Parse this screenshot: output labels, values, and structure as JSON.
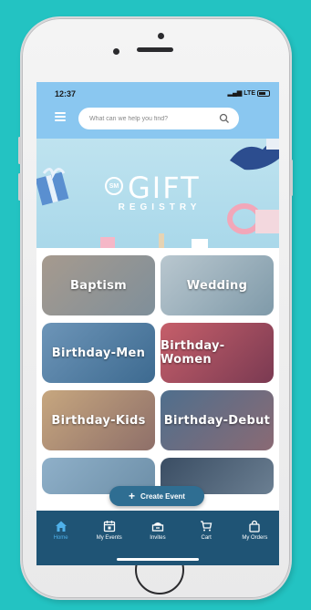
{
  "status_bar": {
    "time": "12:37",
    "network": "LTE"
  },
  "search": {
    "placeholder": "What can we help you find?"
  },
  "banner": {
    "title": "GIFT",
    "subtitle": "REGISTRY",
    "logo": "SM"
  },
  "categories": [
    {
      "label": "Baptism"
    },
    {
      "label": "Wedding"
    },
    {
      "label": "Birthday-Men"
    },
    {
      "label": "Birthday-Women"
    },
    {
      "label": "Birthday-Kids"
    },
    {
      "label": "Birthday-Debut"
    }
  ],
  "create_event": {
    "label": "Create Event"
  },
  "bottom_nav": [
    {
      "label": "Home",
      "icon": "home-icon"
    },
    {
      "label": "My Events",
      "icon": "calendar-icon"
    },
    {
      "label": "Invites",
      "icon": "invites-icon"
    },
    {
      "label": "Cart",
      "icon": "cart-icon"
    },
    {
      "label": "My Orders",
      "icon": "bag-icon"
    }
  ],
  "colors": {
    "background": "#23c3c2",
    "header": "#8ac7f0",
    "nav": "#1f5475",
    "nav_active": "#4fb1ea",
    "fab": "#2f6e92"
  }
}
